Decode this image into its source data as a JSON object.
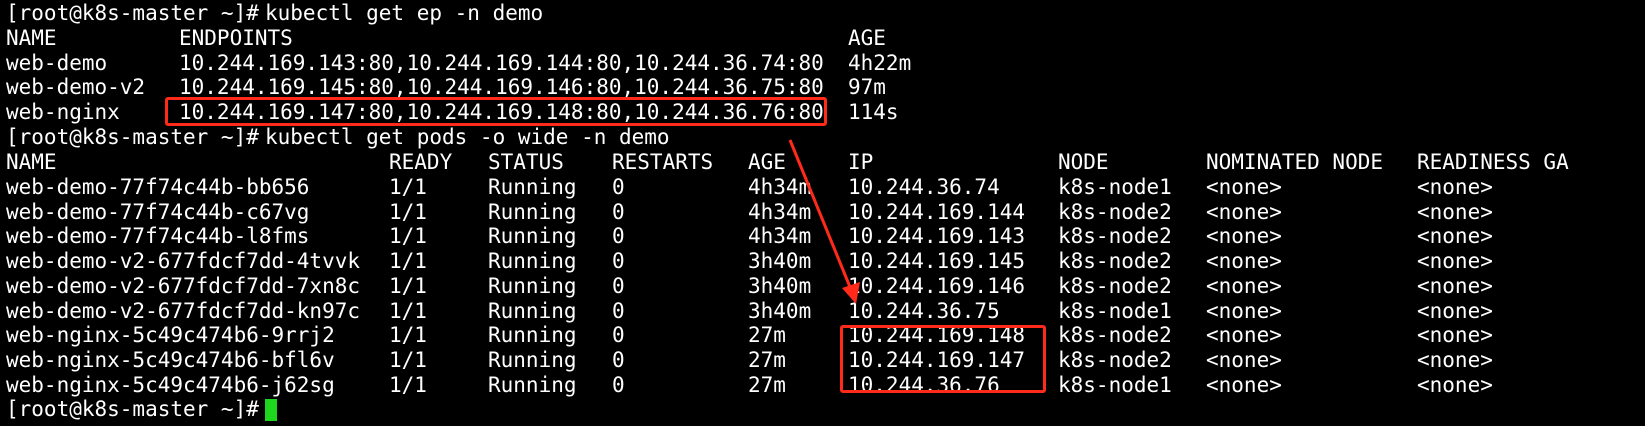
{
  "terminal": {
    "commands": [
      {
        "prompt": "[root@k8s-master ~]# ",
        "command": "kubectl get ep -n demo"
      },
      {
        "prompt": "[root@k8s-master ~]# ",
        "command": "kubectl get pods -o wide -n demo"
      }
    ],
    "endpoints": {
      "headers": [
        "NAME",
        "ENDPOINTS",
        "AGE"
      ],
      "rows": [
        [
          "web-demo",
          "10.244.169.143:80,10.244.169.144:80,10.244.36.74:80",
          "4h22m"
        ],
        [
          "web-demo-v2",
          "10.244.169.145:80,10.244.169.146:80,10.244.36.75:80",
          "97m"
        ],
        [
          "web-nginx",
          "10.244.169.147:80,10.244.169.148:80,10.244.36.76:80",
          "114s"
        ]
      ]
    },
    "pods": {
      "headers": [
        "NAME",
        "READY",
        "STATUS",
        "RESTARTS",
        "AGE",
        "IP",
        "NODE",
        "NOMINATED NODE",
        "READINESS GA"
      ],
      "rows": [
        [
          "web-demo-77f74c44b-bb656",
          "1/1",
          "Running",
          "0",
          "4h34m",
          "10.244.36.74",
          "k8s-node1",
          "<none>",
          "<none>"
        ],
        [
          "web-demo-77f74c44b-c67vg",
          "1/1",
          "Running",
          "0",
          "4h34m",
          "10.244.169.144",
          "k8s-node2",
          "<none>",
          "<none>"
        ],
        [
          "web-demo-77f74c44b-l8fms",
          "1/1",
          "Running",
          "0",
          "4h34m",
          "10.244.169.143",
          "k8s-node2",
          "<none>",
          "<none>"
        ],
        [
          "web-demo-v2-677fdcf7dd-4tvvk",
          "1/1",
          "Running",
          "0",
          "3h40m",
          "10.244.169.145",
          "k8s-node2",
          "<none>",
          "<none>"
        ],
        [
          "web-demo-v2-677fdcf7dd-7xn8c",
          "1/1",
          "Running",
          "0",
          "3h40m",
          "10.244.169.146",
          "k8s-node2",
          "<none>",
          "<none>"
        ],
        [
          "web-demo-v2-677fdcf7dd-kn97c",
          "1/1",
          "Running",
          "0",
          "3h40m",
          "10.244.36.75",
          "k8s-node1",
          "<none>",
          "<none>"
        ],
        [
          "web-nginx-5c49c474b6-9rrj2",
          "1/1",
          "Running",
          "0",
          "27m",
          "10.244.169.148",
          "k8s-node2",
          "<none>",
          "<none>"
        ],
        [
          "web-nginx-5c49c474b6-bfl6v",
          "1/1",
          "Running",
          "0",
          "27m",
          "10.244.169.147",
          "k8s-node2",
          "<none>",
          "<none>"
        ],
        [
          "web-nginx-5c49c474b6-j62sg",
          "1/1",
          "Running",
          "0",
          "27m",
          "10.244.36.76",
          "k8s-node1",
          "<none>",
          "<none>"
        ]
      ]
    },
    "last_prompt": "[root@k8s-master ~]# "
  },
  "colors": {
    "background": "#000000",
    "text": "#ffffff",
    "cursor": "#1fd61f",
    "annotation": "#ff2a1a"
  }
}
